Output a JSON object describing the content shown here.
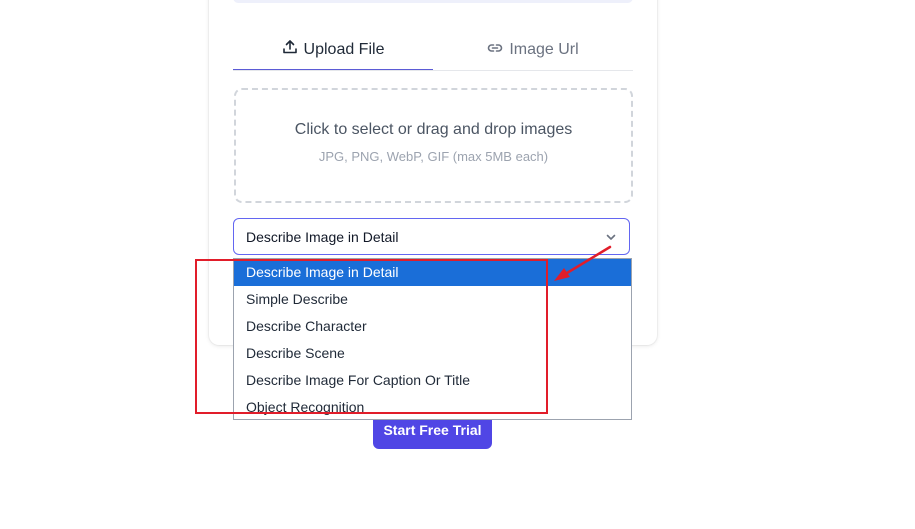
{
  "tabs": {
    "upload": {
      "label": "Upload File",
      "icon": "upload-icon"
    },
    "url": {
      "label": "Image Url",
      "icon": "link-icon"
    }
  },
  "dropzone": {
    "title": "Click to select or drag and drop images",
    "subtitle": "JPG, PNG, WebP, GIF (max 5MB each)"
  },
  "select": {
    "value": "Describe Image in Detail",
    "options": [
      "Describe Image in Detail",
      "Simple Describe",
      "Describe Character",
      "Describe Scene",
      "Describe Image For Caption Or Title",
      "Object Recognition"
    ]
  },
  "cta": {
    "label": "Start Free Trial"
  },
  "colors": {
    "accent": "#5046e5",
    "selected_option": "#1a6ed8",
    "annotation_red": "#e11d2a"
  }
}
